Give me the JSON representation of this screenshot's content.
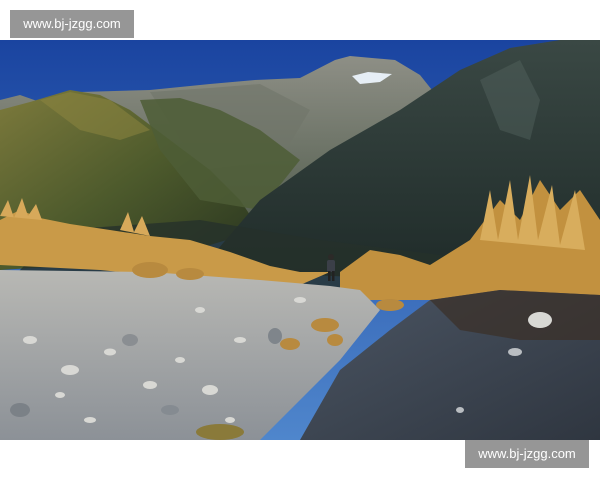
{
  "watermarks": {
    "top_left": "www.bj-jzgg.com",
    "bottom_right": "www.bj-jzgg.com"
  },
  "photo": {
    "scene": "mountain-valley-with-hiker",
    "colors": {
      "sky": "#1f4fa8",
      "mountain_shadow": "#2b3a36",
      "grass": "#c69a45",
      "gravel": "#9fa3a6"
    }
  }
}
